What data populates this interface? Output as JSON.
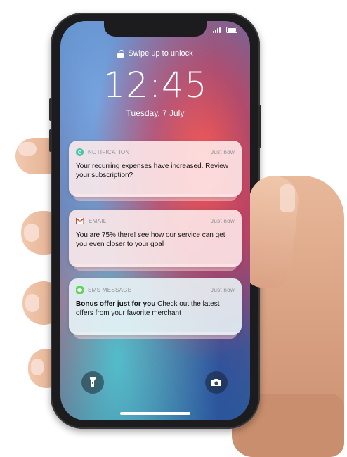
{
  "lock_screen": {
    "unlock_hint": "Swipe up to unlock",
    "time": "12:45",
    "date": "Tuesday, 7 July"
  },
  "notifications": [
    {
      "app": "NOTIFICATION",
      "icon": "notification-app-icon",
      "when": "Just now",
      "bold": "",
      "text": "Your recurring expenses have increased. Review your subscription?"
    },
    {
      "app": "EMAIL",
      "icon": "gmail-icon",
      "when": "Just now",
      "bold": "",
      "text": "You are 75% there! see how our service can get you even closer to your goal"
    },
    {
      "app": "SMS MESSAGE",
      "icon": "messages-icon",
      "when": "Just now",
      "bold": "Bonus offer just for you",
      "text": " Check out the latest offers from your favorite merchant"
    }
  ],
  "quick_actions": {
    "left": "flashlight-icon",
    "right": "camera-icon"
  }
}
